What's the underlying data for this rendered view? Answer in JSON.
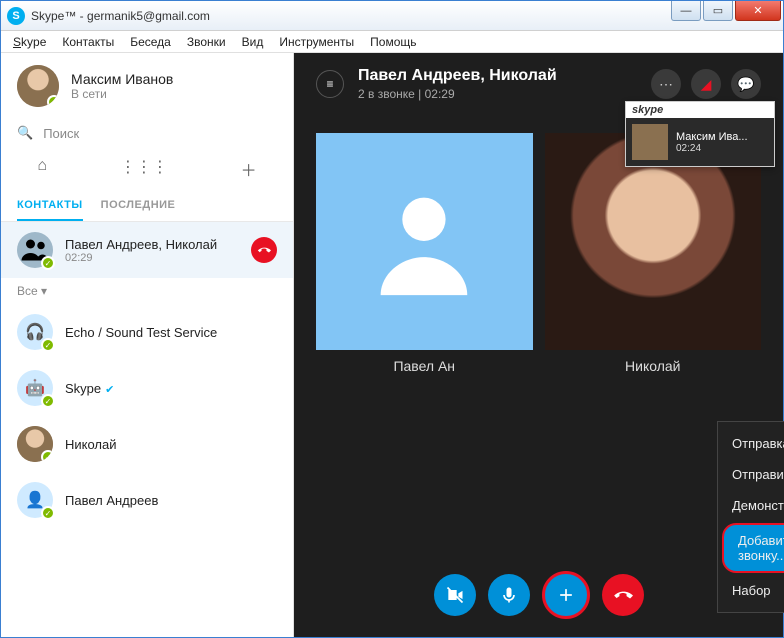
{
  "window": {
    "title": "Skype™ - germanik5@gmail.com"
  },
  "menu": {
    "items": [
      "Skype",
      "Контакты",
      "Беседа",
      "Звонки",
      "Вид",
      "Инструменты",
      "Помощь"
    ]
  },
  "profile": {
    "name": "Максим Иванов",
    "status": "В сети"
  },
  "search": {
    "placeholder": "Поиск"
  },
  "tabs": {
    "contacts": "КОНТАКТЫ",
    "recent": "ПОСЛЕДНИЕ"
  },
  "active_call_item": {
    "name": "Павел Андреев, Николай",
    "time": "02:29"
  },
  "filter": {
    "label": "Все ▾"
  },
  "contacts": [
    {
      "name": "Echo / Sound Test Service",
      "verified": false,
      "icon": "headset"
    },
    {
      "name": "Skype",
      "verified": true,
      "icon": "bot"
    },
    {
      "name": "Николай",
      "verified": false,
      "icon": "photo"
    },
    {
      "name": "Павел Андреев",
      "verified": false,
      "icon": "silhouette"
    }
  ],
  "call": {
    "title": "Павел Андреев, Николай",
    "subtitle": "2 в звонке | 02:29",
    "thumbnail": {
      "brand": "skype",
      "name": "Максим Ива...",
      "time": "02:24"
    },
    "participants": [
      {
        "name": "Павел Ан",
        "type": "placeholder"
      },
      {
        "name": "Николай",
        "type": "photo"
      }
    ]
  },
  "context_menu": {
    "send_files": "Отправка файлов...",
    "send_contacts": "Отправить контакты...",
    "share_screen": "Демонстрация экрана...",
    "add_participants": "Добавить участников к этому звонку...",
    "dial": "Набор"
  }
}
